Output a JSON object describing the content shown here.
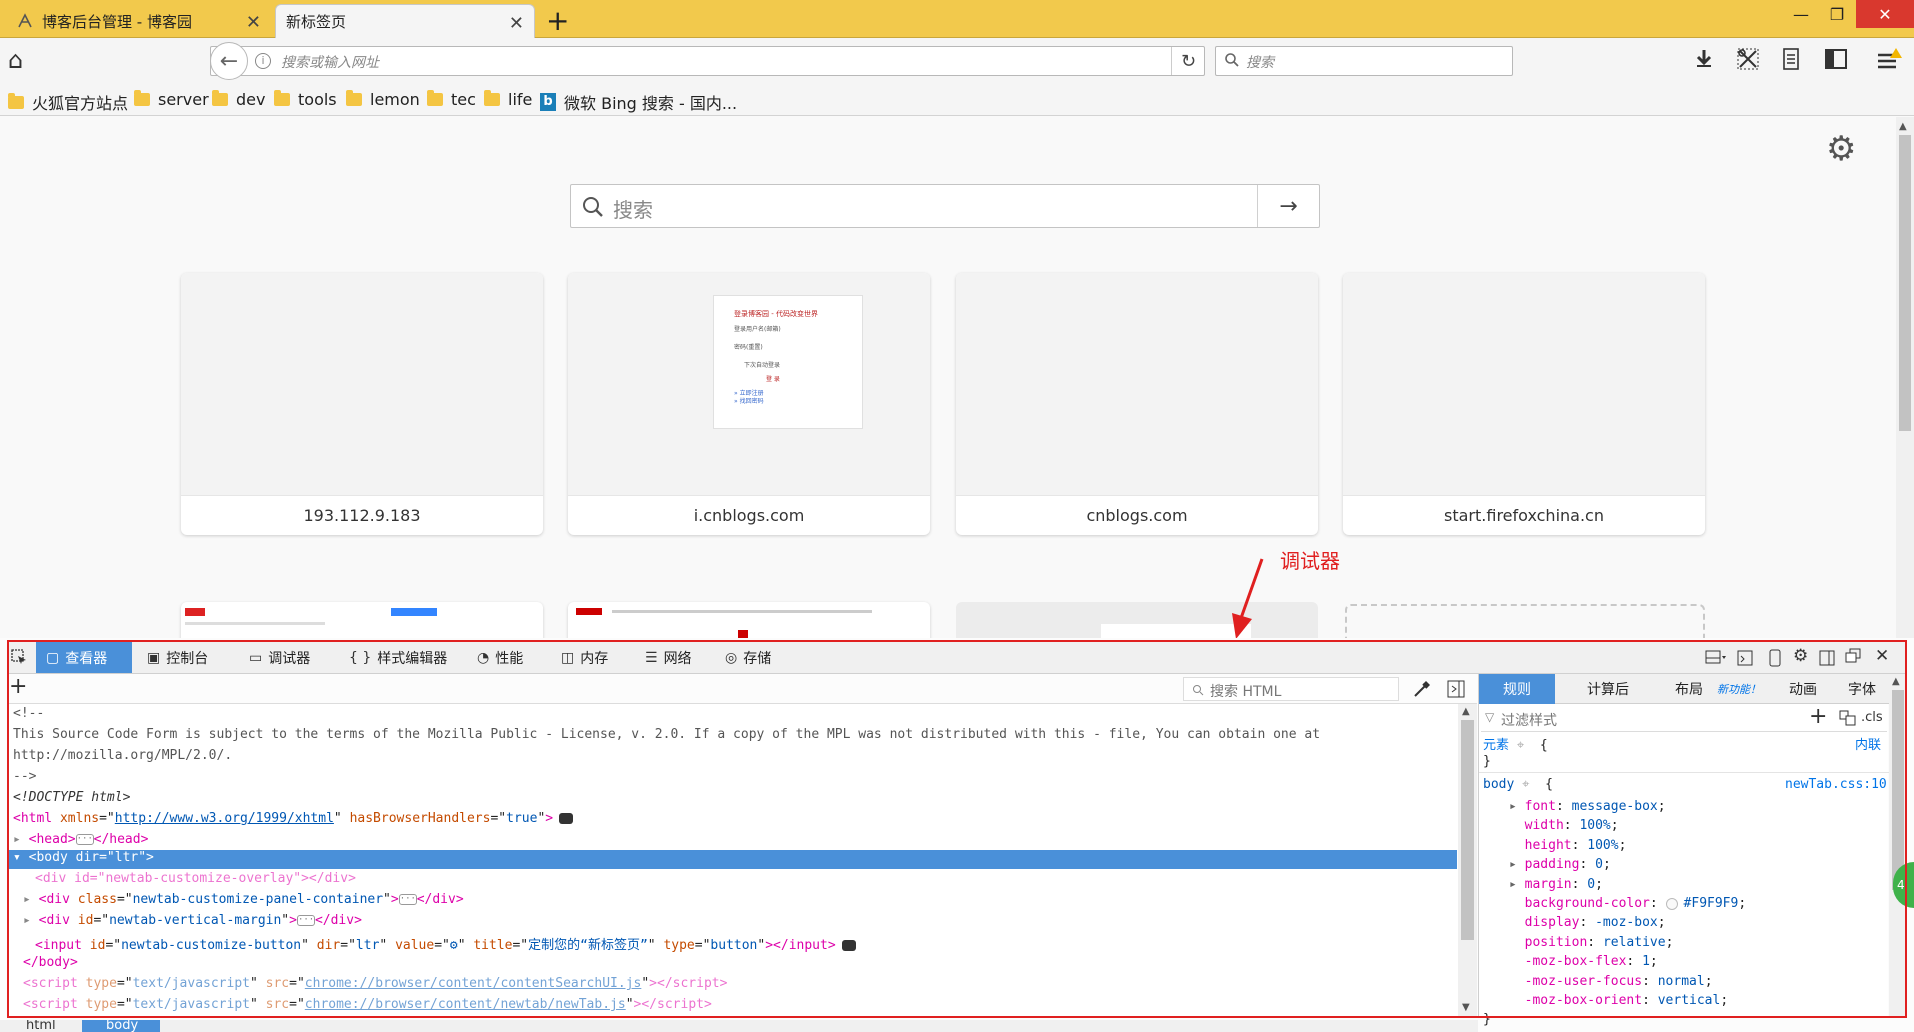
{
  "tabs": [
    {
      "title": "博客后台管理 - 博客园",
      "close": "✕"
    },
    {
      "title": "新标签页",
      "close": "✕"
    }
  ],
  "new_tab": "+",
  "window": {
    "minimize": "—",
    "restore": "❐",
    "close": "✕"
  },
  "nav": {
    "home": "⌂",
    "back": "←",
    "info": "i",
    "url_placeholder": "搜索或输入网址",
    "reload": "↻",
    "search_placeholder": "搜索",
    "search_icon": "search-icon"
  },
  "bookmarks": [
    "火狐官方站点",
    "server",
    "dev",
    "tools",
    "lemon",
    "tec",
    "life",
    "微软 Bing 搜索 - 国内..."
  ],
  "newtab": {
    "search_placeholder": "搜索",
    "go": "→",
    "settings": "⚙",
    "tiles": [
      "193.112.9.183",
      "i.cnblogs.com",
      "cnblogs.com",
      "start.firefoxchina.cn"
    ],
    "thumb_text": [
      "登录博客园 - 代码改变世界",
      "登录用户名(邮箱)",
      "密码(重置)",
      "下次自动登录",
      "登 录",
      "» 立即注册",
      "» 找回密码"
    ]
  },
  "annotation": "调试器",
  "devtools": {
    "tabs": [
      {
        "label": "查看器",
        "icon": "▢"
      },
      {
        "label": "控制台",
        "icon": "▣"
      },
      {
        "label": "调试器",
        "icon": "▭"
      },
      {
        "label": "样式编辑器",
        "icon": "{ }"
      },
      {
        "label": "性能",
        "icon": "◔"
      },
      {
        "label": "内存",
        "icon": "◫"
      },
      {
        "label": "网络",
        "icon": "☰"
      },
      {
        "label": "存储",
        "icon": "◎"
      }
    ],
    "search_html_placeholder": "搜索 HTML",
    "add": "+",
    "markup": {
      "l1": "<!--",
      "l2": "This Source Code Form is subject to the terms of the Mozilla Public - License, v. 2.0. If a copy of the MPL was not distributed with this - file, You can obtain one at",
      "l3": "http://mozilla.org/MPL/2.0/.",
      "l4": "-->",
      "l5": "<!DOCTYPE html>",
      "html_open": "<html",
      "xmlns_attr": "xmlns",
      "xmlns_val": "http://www.w3.org/1999/xhtml",
      "hbh_attr": "hasBrowserHandlers",
      "hbh_val": "true",
      "head": "<head>",
      "head_close": "</head>",
      "body_open": "<body dir=\"ltr\">",
      "div1": "<div id=\"newtab-customize-overlay\"></div>",
      "div2_open": "<div",
      "div2_attr": "class",
      "div2_val": "newtab-customize-panel-container",
      "div_close": "</div>",
      "div3_attr": "id",
      "div3_val": "newtab-vertical-margin",
      "input_tag": "<input",
      "input_id_val": "newtab-customize-button",
      "input_dir": "dir",
      "input_dir_val": "ltr",
      "input_value": "value",
      "input_value_val": "⚙",
      "input_title": "title",
      "input_title_val": "定制您的“新标签页”",
      "input_type": "type",
      "input_type_val": "button",
      "input_close": "></input>",
      "body_close": "</body>",
      "script1": "chrome://browser/content/contentSearchUI.js",
      "script2": "chrome://browser/content/newtab/newTab.js",
      "script_type": "text/javascript"
    },
    "breadcrumb": [
      "html",
      "body"
    ],
    "rules_tabs": [
      "规则",
      "计算后",
      "布局",
      "新功能！",
      "动画",
      "字体"
    ],
    "filter_placeholder": "过滤样式",
    "cls": ".cls",
    "element_label": "元素",
    "inline": "内联",
    "body_selector": "body",
    "source": "newTab.css:10",
    "decls": [
      {
        "p": "font",
        "v": "message-box",
        "exp": true
      },
      {
        "p": "width",
        "v": "100%",
        "exp": false
      },
      {
        "p": "height",
        "v": "100%",
        "exp": false
      },
      {
        "p": "padding",
        "v": "0",
        "exp": true
      },
      {
        "p": "margin",
        "v": "0",
        "exp": true
      },
      {
        "p": "background-color",
        "v": "#F9F9F9",
        "exp": false
      },
      {
        "p": "display",
        "v": "-moz-box",
        "exp": false
      },
      {
        "p": "position",
        "v": "relative",
        "exp": false
      },
      {
        "p": "-moz-box-flex",
        "v": "1",
        "exp": false
      },
      {
        "p": "-moz-user-focus",
        "v": "normal",
        "exp": false
      },
      {
        "p": "-moz-box-orient",
        "v": "vertical",
        "exp": false
      }
    ]
  }
}
